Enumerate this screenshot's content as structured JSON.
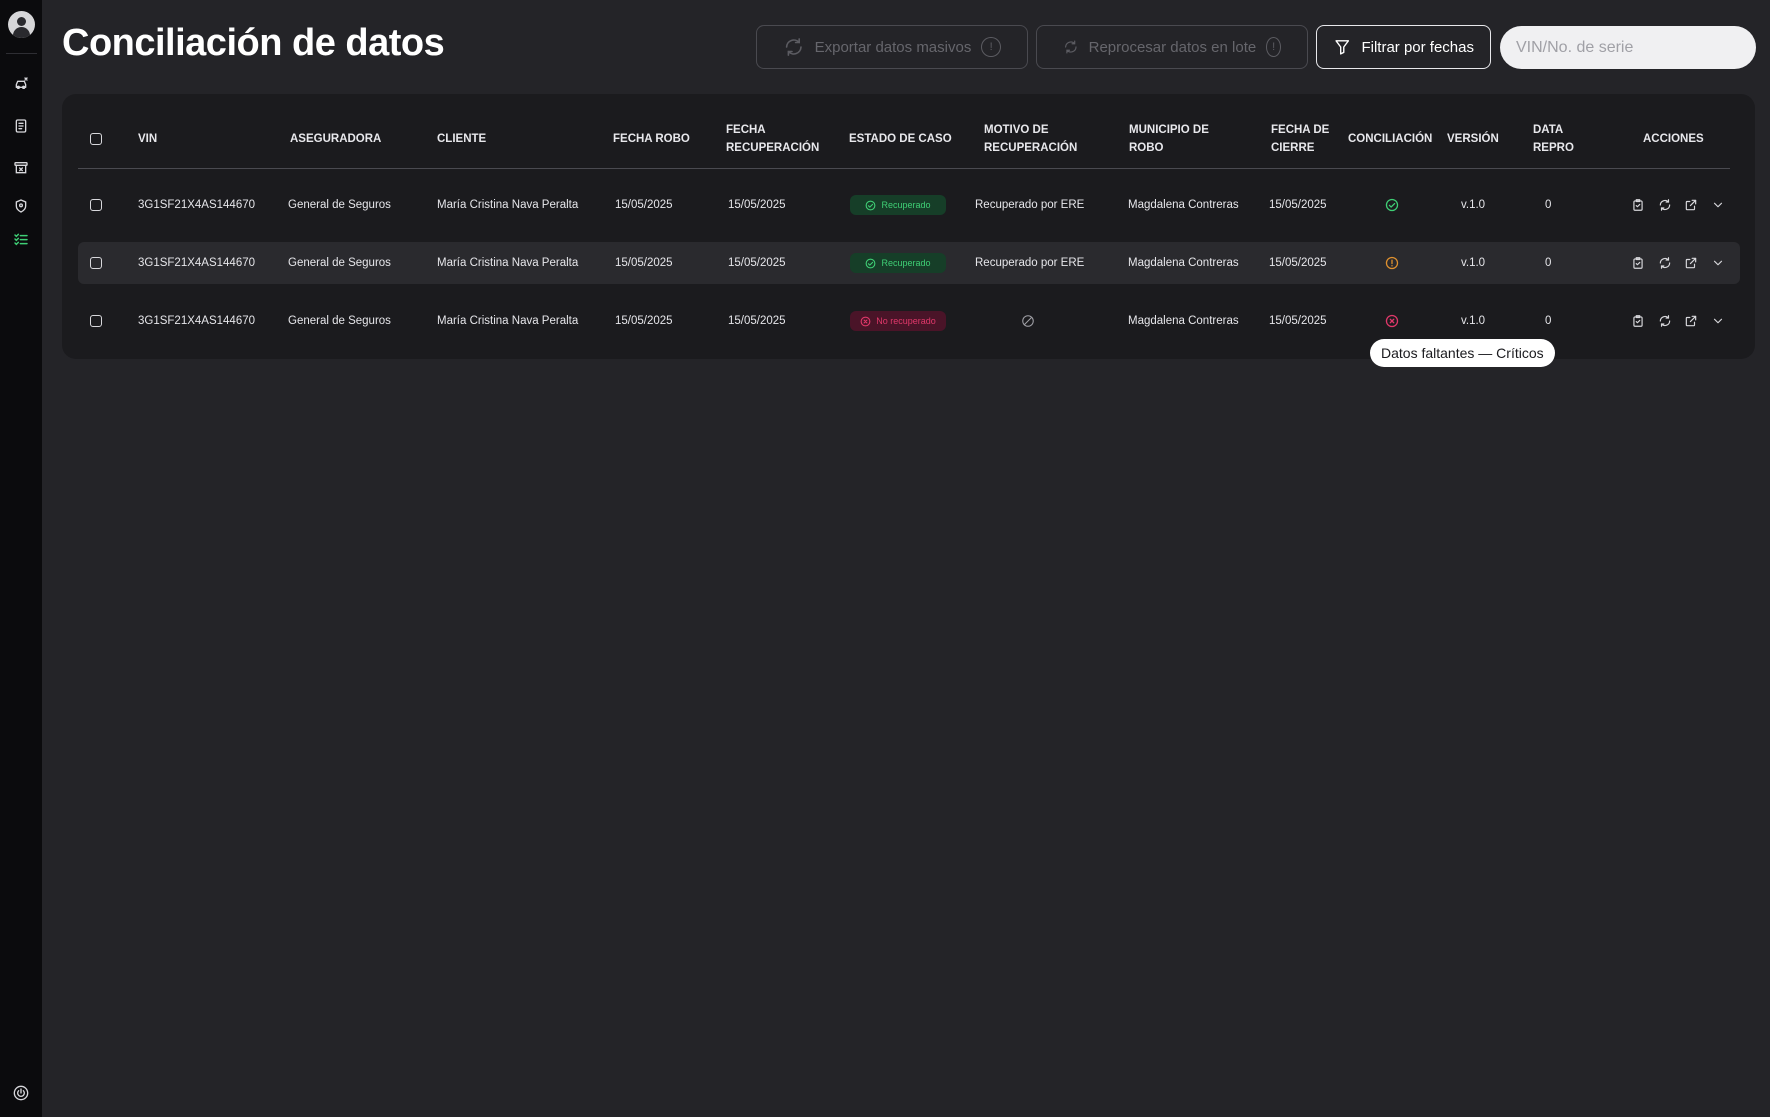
{
  "page": {
    "title": "Conciliación de datos"
  },
  "toolbar": {
    "export_label": "Exportar datos masivos",
    "reprocess_label": "Reprocesar datos en lote",
    "filter_label": "Filtrar por fechas",
    "info_glyph": "!"
  },
  "search": {
    "placeholder": "VIN/No. de serie",
    "value": ""
  },
  "sidebar": {
    "items": [
      {
        "name": "avatar",
        "icon": "user-icon"
      },
      {
        "name": "vehicles",
        "icon": "car-icon"
      },
      {
        "name": "documents",
        "icon": "document-icon"
      },
      {
        "name": "archive",
        "icon": "archive-icon"
      },
      {
        "name": "security",
        "icon": "shield-icon"
      },
      {
        "name": "reconciliation",
        "icon": "checklist-icon",
        "active": true
      },
      {
        "name": "logout",
        "icon": "power-icon"
      }
    ]
  },
  "table": {
    "headers": {
      "vin": "VIN",
      "aseguradora": "ASEGURADORA",
      "cliente": "CLIENTE",
      "fecha_robo": "FECHA ROBO",
      "fecha_recuperacion_1": "FECHA",
      "fecha_recuperacion_2": "RECUPERACIÓN",
      "estado": "ESTADO DE CASO",
      "motivo_1": "MOTIVO DE",
      "motivo_2": "RECUPERACIÓN",
      "municipio_1": "MUNICIPIO DE",
      "municipio_2": "ROBO",
      "cierre_1": "FECHA DE",
      "cierre_2": "CIERRE",
      "conciliacion": "CONCILIACIÓN",
      "version": "VERSIÓN",
      "data_1": "DATA",
      "data_2": "REPRO",
      "acciones": "ACCIONES"
    },
    "rows": [
      {
        "vin": "3G1SF21X4AS144670",
        "aseguradora": "General de Seguros",
        "cliente": "María Cristina Nava Peralta",
        "fecha_robo": "15/05/2025",
        "fecha_recuperacion": "15/05/2025",
        "estado": "Recuperado",
        "estado_tipo": "ok",
        "motivo": "Recuperado por ERE",
        "municipio": "Magdalena Contreras",
        "fecha_cierre": "15/05/2025",
        "conciliacion": "ok",
        "version": "v.1.0",
        "data_repro": "0"
      },
      {
        "vin": "3G1SF21X4AS144670",
        "aseguradora": "General de Seguros",
        "cliente": "María Cristina Nava Peralta",
        "fecha_robo": "15/05/2025",
        "fecha_recuperacion": "15/05/2025",
        "estado": "Recuperado",
        "estado_tipo": "ok",
        "motivo": "Recuperado por ERE",
        "municipio": "Magdalena Contreras",
        "fecha_cierre": "15/05/2025",
        "conciliacion": "warning",
        "version": "v.1.0",
        "data_repro": "0"
      },
      {
        "vin": "3G1SF21X4AS144670",
        "aseguradora": "General de Seguros",
        "cliente": "María Cristina Nava Peralta",
        "fecha_robo": "15/05/2025",
        "fecha_recuperacion": "15/05/2025",
        "estado": "No recuperado",
        "estado_tipo": "bad",
        "motivo": "",
        "municipio": "Magdalena Contreras",
        "fecha_cierre": "15/05/2025",
        "conciliacion": "error",
        "version": "v.1.0",
        "data_repro": "0"
      }
    ]
  },
  "tooltip": {
    "text": "Datos faltantes — Críticos"
  },
  "colors": {
    "success": "#3fcf75",
    "warning": "#e0912f",
    "danger": "#e0386a",
    "background": "#242428",
    "card": "#1b1b1e",
    "sidebar": "#0b0b0d"
  }
}
